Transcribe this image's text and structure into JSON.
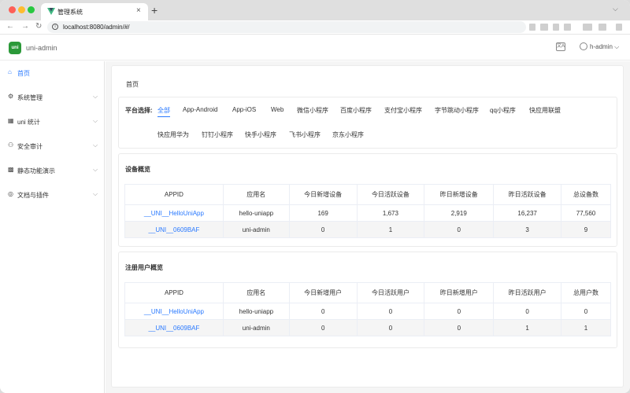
{
  "browser": {
    "tab_title": "管理系统",
    "tab_close": "×",
    "new_tab": "+",
    "nav": {
      "back": "←",
      "forward": "→",
      "reload": "↻"
    },
    "url": "localhost:8080/admin/#/"
  },
  "header": {
    "app_name": "uni-admin",
    "logo_text": "uni",
    "lang_icon_text": "文A",
    "user_name": "h-admin ⌵"
  },
  "sidebar": {
    "items": [
      {
        "icon": "⌂",
        "label": "首页",
        "arrow": ""
      },
      {
        "icon": "⚙",
        "label": "系统管理",
        "arrow": "⌵"
      },
      {
        "icon": "▦",
        "label": "uni 统计",
        "arrow": "⌵"
      },
      {
        "icon": "⚇",
        "label": "安全审计",
        "arrow": "⌵"
      },
      {
        "icon": "▩",
        "label": "静态功能演示",
        "arrow": "⌵"
      },
      {
        "icon": "◎",
        "label": "文档与插件",
        "arrow": "⌵"
      }
    ]
  },
  "main": {
    "breadcrumb": "首页",
    "platform_label": "平台选择:",
    "platforms": [
      "全部",
      "App-Android",
      "App-iOS",
      "Web",
      "微信小程序",
      "百度小程序",
      "支付宝小程序",
      "字节跳动小程序",
      "qq小程序",
      "快应用联盟",
      "快应用华为",
      "钉钉小程序",
      "快手小程序",
      "飞书小程序",
      "京东小程序"
    ],
    "active_platform": "全部",
    "device_section": {
      "title": "设备概览",
      "columns": [
        "APPID",
        "应用名",
        "今日新增设备",
        "今日活跃设备",
        "昨日新增设备",
        "昨日活跃设备",
        "总设备数"
      ],
      "rows": [
        [
          "__UNI__HelloUniApp",
          "hello-uniapp",
          "169",
          "1,673",
          "2,919",
          "16,237",
          "77,560"
        ],
        [
          "__UNI__0609BAF",
          "uni-admin",
          "0",
          "1",
          "0",
          "3",
          "9"
        ]
      ]
    },
    "user_section": {
      "title": "注册用户概览",
      "columns": [
        "APPID",
        "应用名",
        "今日新增用户",
        "今日活跃用户",
        "昨日新增用户",
        "昨日活跃用户",
        "总用户数"
      ],
      "rows": [
        [
          "__UNI__HelloUniApp",
          "hello-uniapp",
          "0",
          "0",
          "0",
          "0",
          "0"
        ],
        [
          "__UNI__0609BAF",
          "uni-admin",
          "0",
          "0",
          "0",
          "1",
          "1"
        ]
      ]
    }
  },
  "colors": {
    "accent": "#2979ff",
    "brand_green": "#2b9939"
  }
}
